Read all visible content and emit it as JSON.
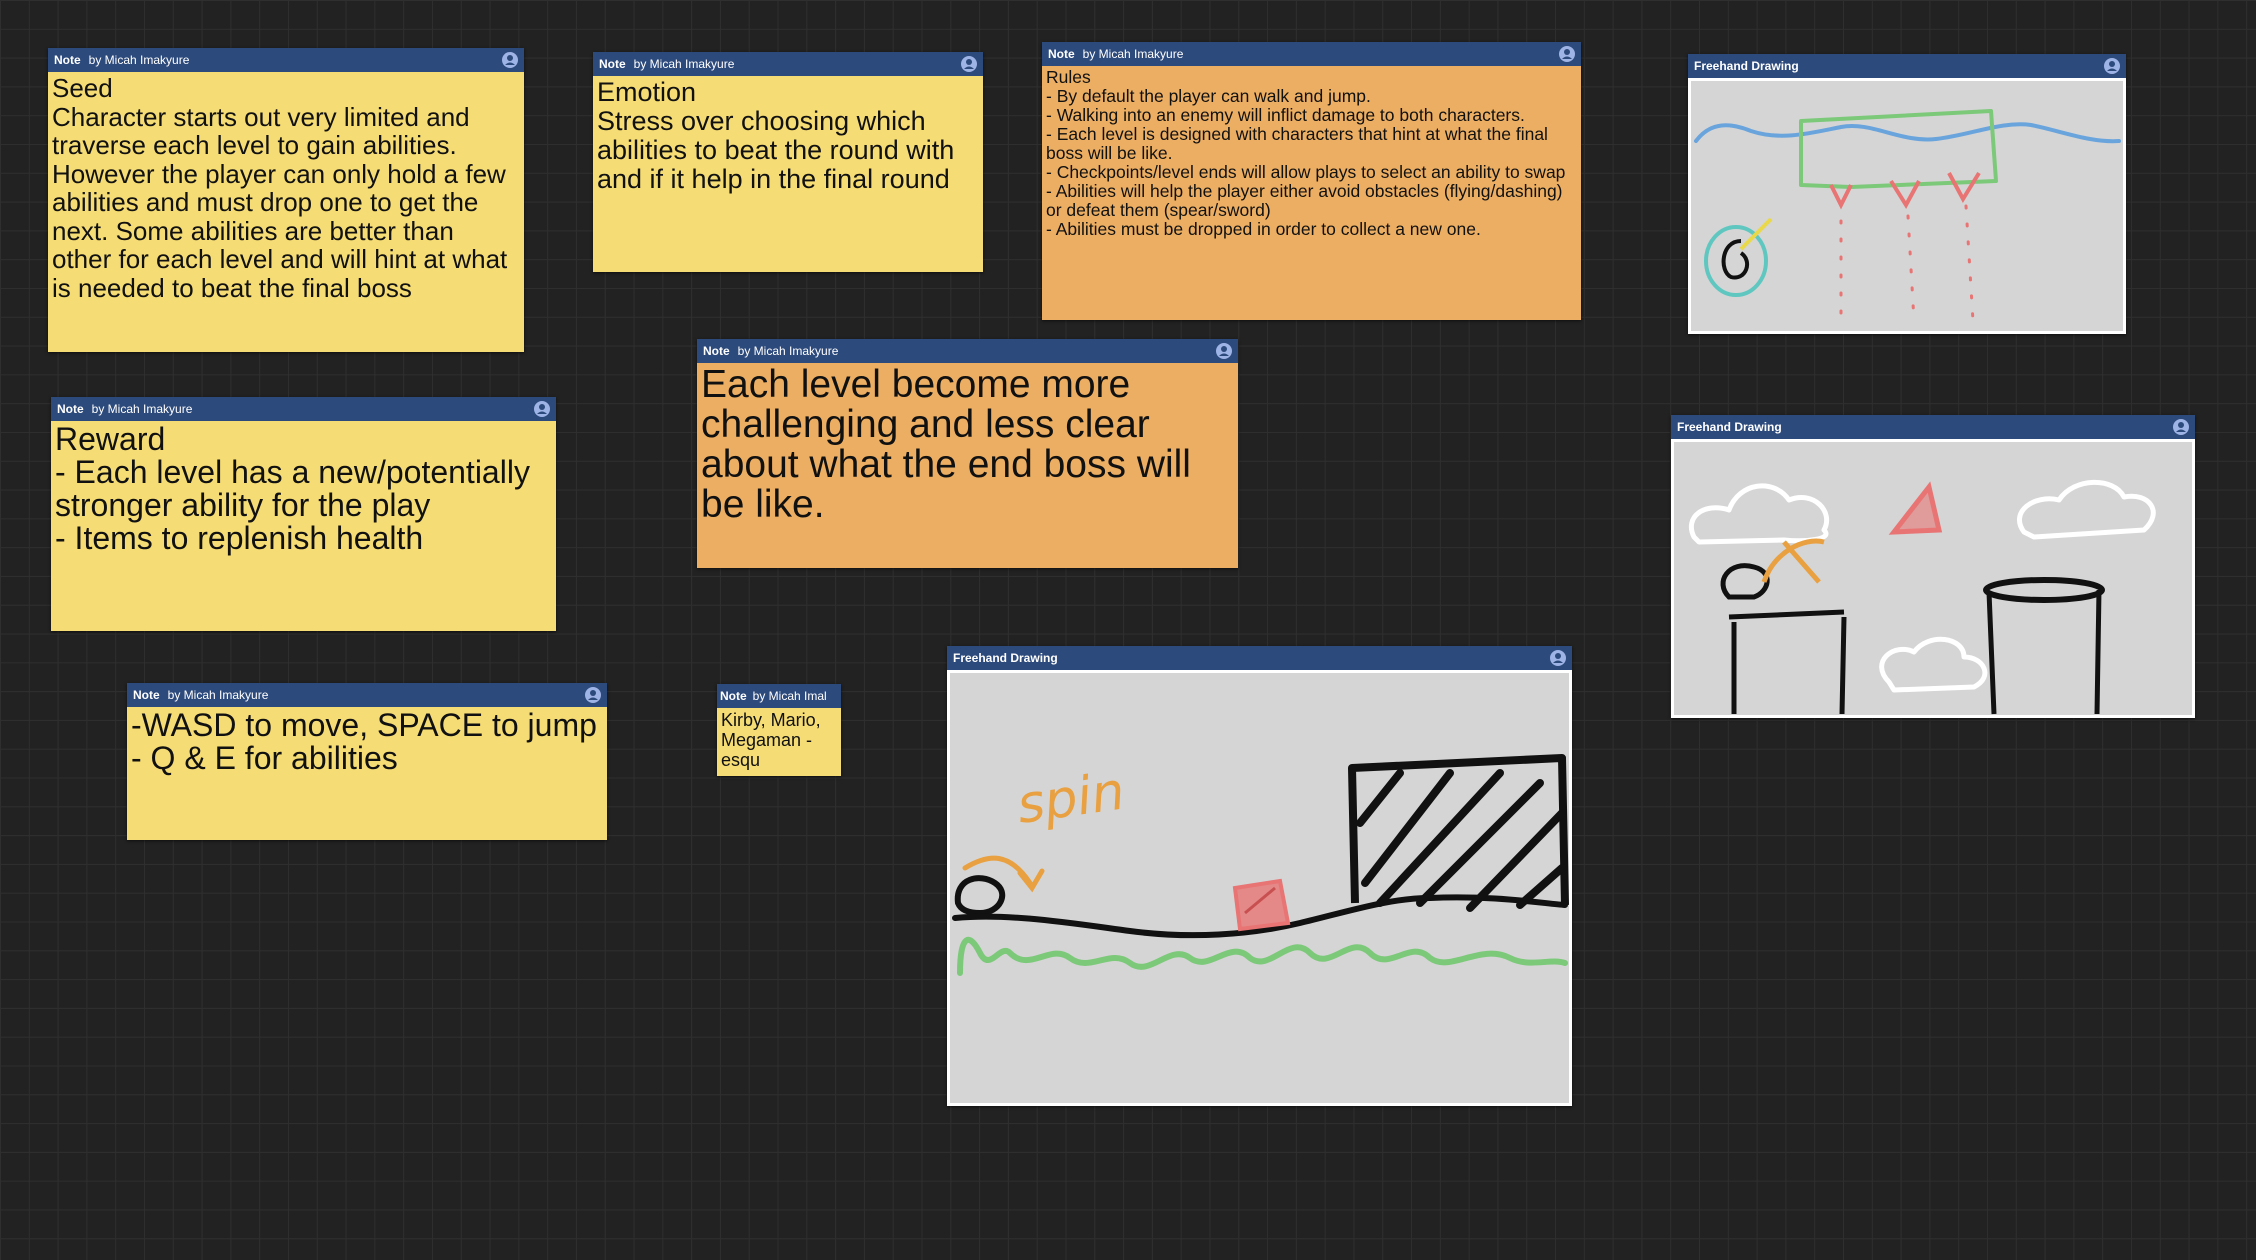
{
  "board": {
    "background_color": "#222222",
    "header_color": "#2d4a7c",
    "note_yellow": "#f5dc74",
    "note_orange": "#ecae62"
  },
  "notes": {
    "seed": {
      "type": "Note",
      "author": "by Micah Imakyure",
      "text": "Seed\nCharacter starts out very limited and traverse each level to gain abilities. However the player can only hold a few abilities and must drop one to get the next. Some abilities are better than other for each level and will hint at what is needed to beat the final boss"
    },
    "emotion": {
      "type": "Note",
      "author": "by Micah Imakyure",
      "text": "Emotion\nStress over choosing which abilities to beat the round with and if it help in the final round"
    },
    "rules": {
      "type": "Note",
      "author": "by Micah Imakyure",
      "text": "Rules\n- By default the player can walk and jump.\n- Walking into an enemy will inflict damage to both characters.\n- Each level is designed with characters that hint at what the final boss will be like.\n- Checkpoints/level ends will allow plays to select an ability to swap\n- Abilities will help the player either avoid obstacles (flying/dashing) or defeat them (spear/sword)\n- Abilities must be dropped in order to collect a new one."
    },
    "reward": {
      "type": "Note",
      "author": "by Micah Imakyure",
      "text": "Reward\n- Each level has a new/potentially stronger ability for the play\n- Items to replenish health"
    },
    "challenge": {
      "type": "Note",
      "author": "by Micah Imakyure",
      "text": "Each level become more challenging and less clear about what the end boss will be like."
    },
    "controls": {
      "type": "Note",
      "author": "by Micah Imakyure",
      "text": "-WASD to move, SPACE to jump\n- Q & E for abilities"
    },
    "inspiration": {
      "type": "Note",
      "author": "by Micah Imal",
      "text": "Kirby, Mario, Megaman - esqu"
    }
  },
  "drawings": {
    "top_right": {
      "type": "Freehand Drawing"
    },
    "mid_right": {
      "type": "Freehand Drawing"
    },
    "center": {
      "type": "Freehand Drawing",
      "sketch_text": "spin"
    }
  },
  "icons": {
    "avatar": "user-avatar-icon"
  }
}
